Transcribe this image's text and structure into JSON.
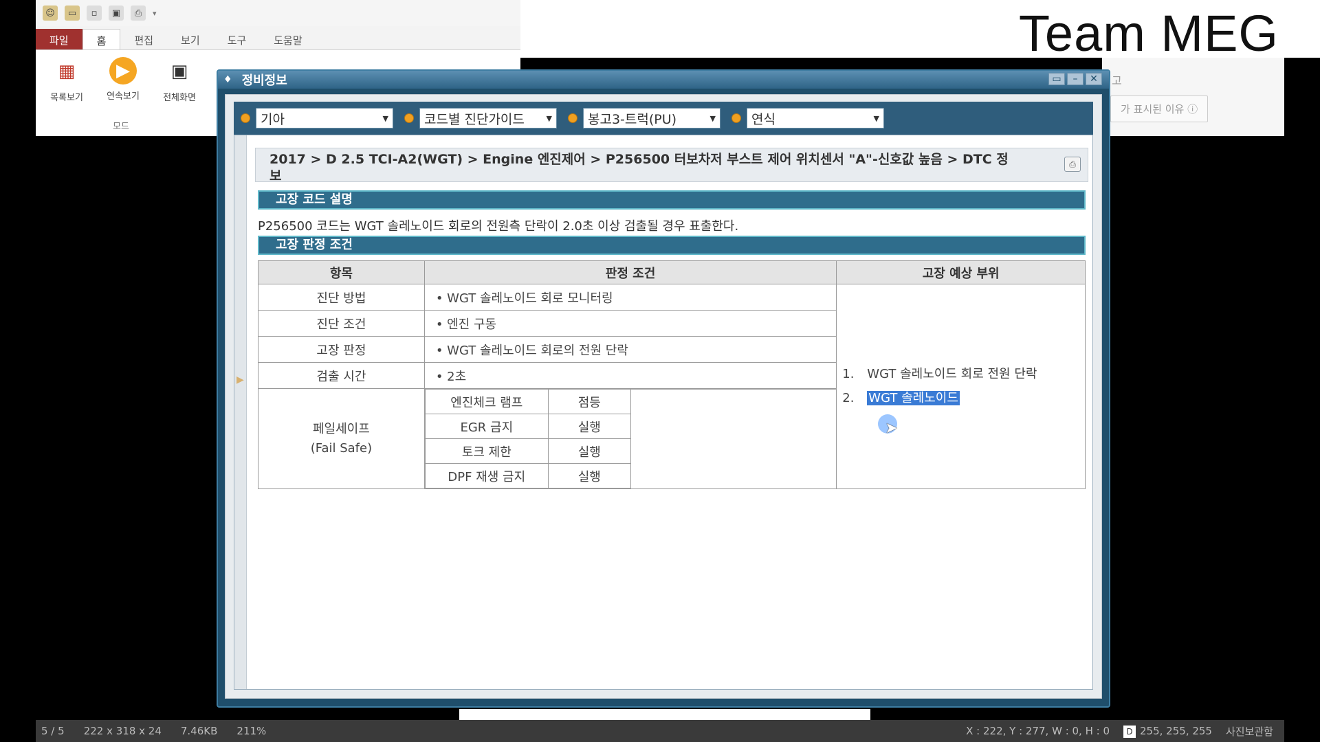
{
  "brand": {
    "text": "Team MEG"
  },
  "viewer": {
    "tabs": [
      "파일",
      "홈",
      "편집",
      "보기",
      "도구",
      "도움말"
    ],
    "tools": [
      {
        "label": "목록보기",
        "icon": "grid-icon"
      },
      {
        "label": "연속보기",
        "icon": "play-icon"
      },
      {
        "label": "전체화면",
        "icon": "fullscreen-icon"
      }
    ],
    "group_label": "모드"
  },
  "bg_panel": {
    "text": "고",
    "button": "가 표시된 이유"
  },
  "dialog": {
    "title": "정비정보",
    "filters": [
      {
        "value": "기아"
      },
      {
        "value": "코드별 진단가이드"
      },
      {
        "value": "봉고3-트럭(PU)"
      },
      {
        "value": "연식"
      }
    ],
    "breadcrumb": "2017 > D 2.5 TCI-A2(WGT) > Engine 엔진제어 > P256500 터보차저 부스트 제어 위치센서 \"A\"-신호값 높음 > DTC 정보",
    "section_desc": "고장 코드 설명",
    "desc_text": "P256500 코드는 WGT 솔레노이드 회로의 전원측 단락이 2.0초 이상 검출될 경우 표출한다.",
    "section_cond": "고장 판정 조건",
    "table": {
      "headers": [
        "항목",
        "판정 조건",
        "고장 예상 부위"
      ],
      "rows": [
        {
          "item": "진단 방법",
          "cond": "• WGT 솔레노이드 회로 모니터링"
        },
        {
          "item": "진단 조건",
          "cond": "• 엔진 구동"
        },
        {
          "item": "고장 판정",
          "cond": "• WGT 솔레노이드 회로의 전원 단락"
        },
        {
          "item": "검출 시간",
          "cond": "• 2초"
        }
      ],
      "failsafe_label": "페일세이프",
      "failsafe_sub": "(Fail Safe)",
      "failsafe_rows": [
        {
          "name": "엔진체크 램프",
          "state": "점등"
        },
        {
          "name": "EGR 금지",
          "state": "실행"
        },
        {
          "name": "토크 제한",
          "state": "실행"
        },
        {
          "name": "DPF 재생 금지",
          "state": "실행"
        }
      ],
      "parts": [
        {
          "num": "1.",
          "text": "WGT 솔레노이드 회로 전원 단락"
        },
        {
          "num": "2.",
          "text": "WGT 솔레노이드"
        }
      ]
    }
  },
  "status": {
    "page": "5 / 5",
    "dims": "222 x 318 x 24",
    "size": "7.46KB",
    "zoom": "211%",
    "coords": "X : 222, Y : 277, W : 0, H : 0",
    "chip": "D",
    "rgb": "255, 255, 255",
    "right_label": "사진보관함"
  }
}
